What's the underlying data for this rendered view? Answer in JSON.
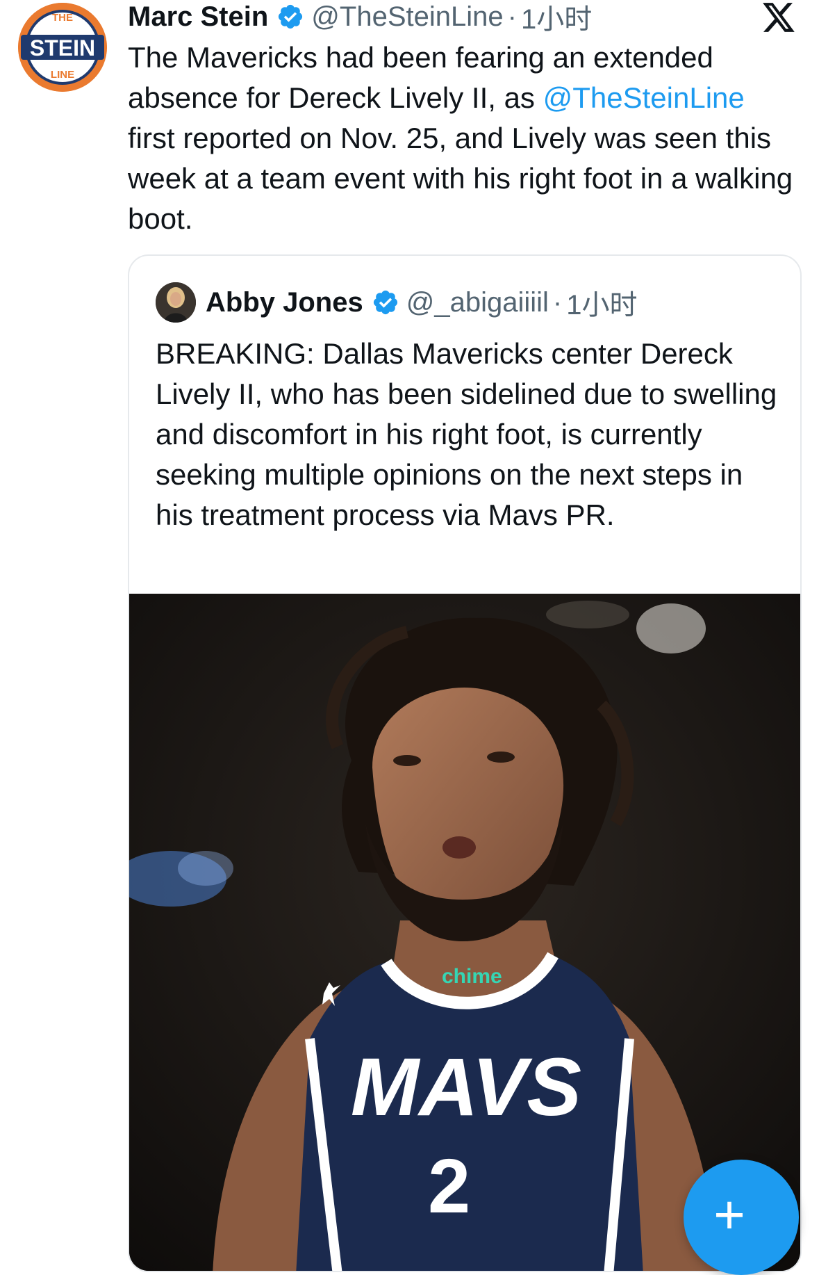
{
  "tweet": {
    "author_name": "Marc Stein",
    "handle": "@TheSteinLine",
    "separator": "·",
    "time": "1小时",
    "avatar_logo_text": {
      "top": "THE",
      "middle": "STEIN",
      "bottom": "LINE"
    },
    "text_part1": "The Mavericks had been fearing an extended absence for Dereck Lively II, as ",
    "mention": "@TheSteinLine",
    "text_part2": " first reported on Nov. 25, and Lively was seen this week at a team event with his right foot in a walking boot."
  },
  "quoted_tweet": {
    "author_name": "Abby Jones",
    "handle": "@_abigaiiiil",
    "separator": "·",
    "time": "1小时",
    "text": "BREAKING: Dallas Mavericks center Dereck Lively II, who has been sidelined due to swelling and discomfort in his right foot, is currently seeking multiple opinions on the next steps in his treatment process via Mavs PR.",
    "photo_text": {
      "sponsor": "chime",
      "jersey": "MAVS",
      "number": "2"
    }
  },
  "fab": {
    "label": "+"
  },
  "colors": {
    "accent": "#1d9bf0",
    "secondary_text": "#536471",
    "logo_orange": "#ea7a2f",
    "logo_navy": "#1f3a6e",
    "jersey_navy": "#1b2a4e"
  },
  "icons": {
    "verified": "verified-badge-icon",
    "platform": "x-logo-icon",
    "compose": "plus-icon"
  }
}
